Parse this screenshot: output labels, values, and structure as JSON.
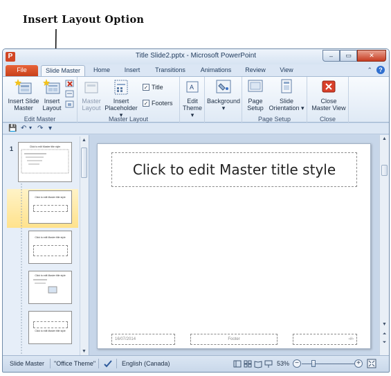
{
  "annotation": {
    "text": "Insert Layout Option"
  },
  "window": {
    "title": "Title Slide2.pptx - Microsoft PowerPoint",
    "app_icon": "P",
    "controls": {
      "minimize": "–",
      "maximize": "▭",
      "close": "✕"
    }
  },
  "tabs": [
    {
      "label": "File"
    },
    {
      "label": "Slide Master"
    },
    {
      "label": "Home"
    },
    {
      "label": "Insert"
    },
    {
      "label": "Transitions"
    },
    {
      "label": "Animations"
    },
    {
      "label": "Review"
    },
    {
      "label": "View"
    }
  ],
  "tab_right": {
    "collapse": "⌃",
    "help": "?"
  },
  "ribbon": {
    "groups": {
      "edit_master": {
        "label": "Edit Master",
        "insert_slide_master": {
          "line1": "Insert Slide",
          "line2": "Master"
        },
        "insert_layout": {
          "line1": "Insert",
          "line2": "Layout"
        }
      },
      "master_layout": {
        "label": "Master Layout",
        "master_layout_btn": {
          "line1": "Master",
          "line2": "Layout"
        },
        "insert_placeholder": {
          "line1": "Insert",
          "line2": "Placeholder"
        },
        "title_check": {
          "label": "Title",
          "checked": "✓"
        },
        "footers_check": {
          "label": "Footers",
          "checked": "✓"
        }
      },
      "edit_theme": {
        "label": "",
        "edit_theme_btn": {
          "line1": "Edit",
          "line2": "Theme"
        }
      },
      "background": {
        "background_btn": {
          "line1": "Background"
        }
      },
      "page_setup": {
        "label": "Page Setup",
        "page_setup_btn": {
          "line1": "Page",
          "line2": "Setup"
        },
        "slide_orientation": {
          "line1": "Slide",
          "line2": "Orientation"
        }
      },
      "close": {
        "label": "Close",
        "close_master_view": {
          "line1": "Close",
          "line2": "Master View"
        }
      }
    }
  },
  "qat": {
    "save": "💾",
    "undo": "↶",
    "redo": "↷",
    "customize": "▾"
  },
  "thumbnails": {
    "slide_number": "1",
    "items": [
      {
        "title": "Click to edit Master title style"
      },
      {
        "title": "Click to edit Master title style"
      },
      {
        "title": "Click to edit Master title style"
      },
      {
        "title": "Click to edit Master title style"
      },
      {
        "title": "Click to edit Master title style"
      }
    ]
  },
  "slide": {
    "title_placeholder": "Click to edit Master title style",
    "date": "16/07/2014",
    "footer": "Footer",
    "slide_num": "‹#›"
  },
  "status": {
    "view": "Slide Master",
    "theme": "\"Office Theme\"",
    "language": "English (Canada)",
    "zoom": "53%",
    "zoom_out": "−",
    "zoom_in": "+"
  }
}
